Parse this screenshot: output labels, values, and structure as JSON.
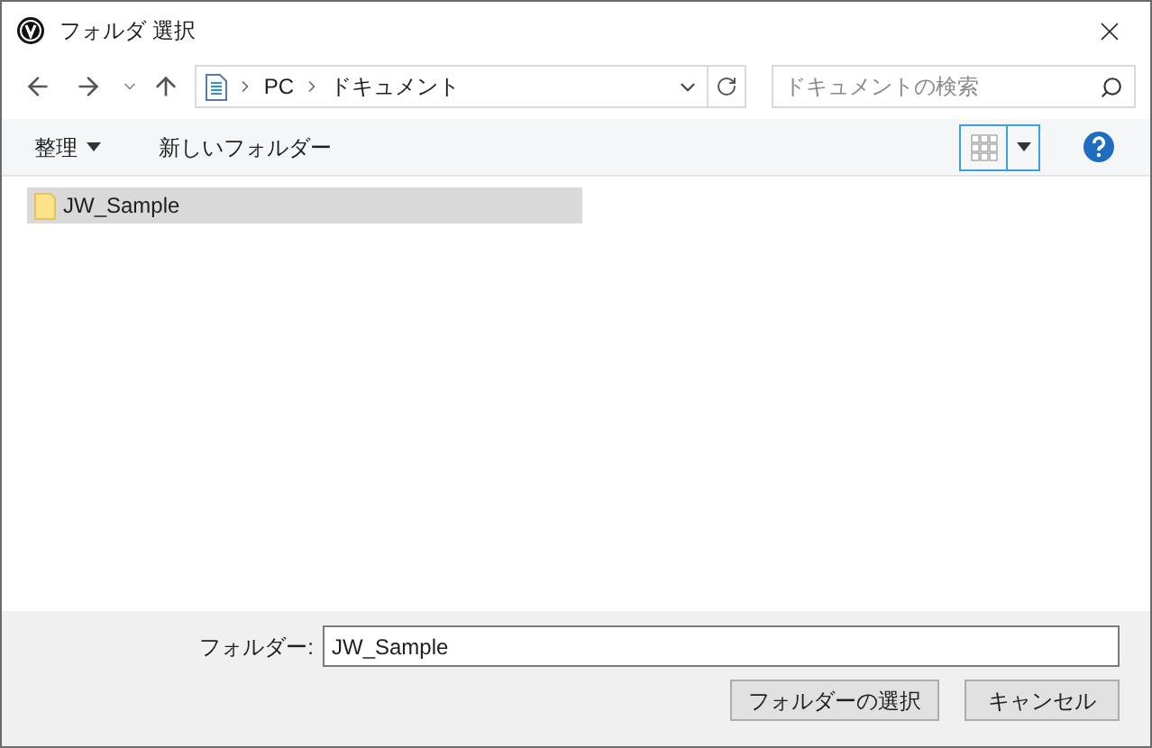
{
  "window": {
    "title": "フォルダ 選択"
  },
  "address": {
    "crumbs": [
      "PC",
      "ドキュメント"
    ]
  },
  "search": {
    "placeholder": "ドキュメントの検索"
  },
  "toolbar": {
    "organize": "整理",
    "new_folder": "新しいフォルダー"
  },
  "items": [
    {
      "name": "JW_Sample",
      "selected": true
    }
  ],
  "footer": {
    "label": "フォルダー:",
    "value": "JW_Sample",
    "buttons": [
      "フォルダーの選択",
      "キャンセル"
    ]
  }
}
